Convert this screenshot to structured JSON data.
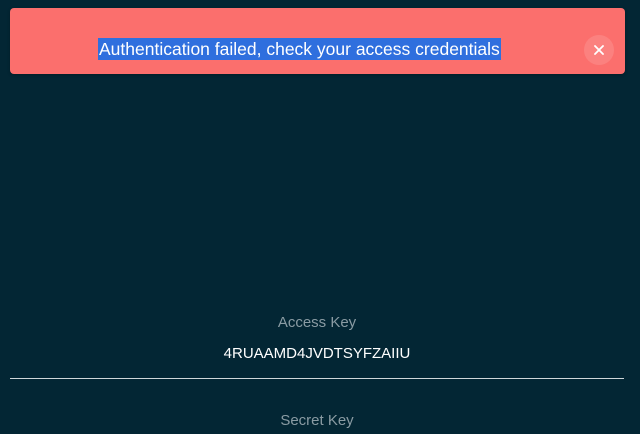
{
  "alert": {
    "message": "Authentication failed, check your access credentials",
    "close_icon": "close-icon",
    "color": "#fb6f6d",
    "selection_color": "#2f6fde"
  },
  "form": {
    "access_key_label": "Access Key",
    "access_key_value": "4RUAAMD4JVDTSYFZAIIU",
    "secret_key_label": "Secret Key"
  },
  "colors": {
    "background": "#032634",
    "label": "#8a9ba3",
    "value": "#ffffff"
  }
}
